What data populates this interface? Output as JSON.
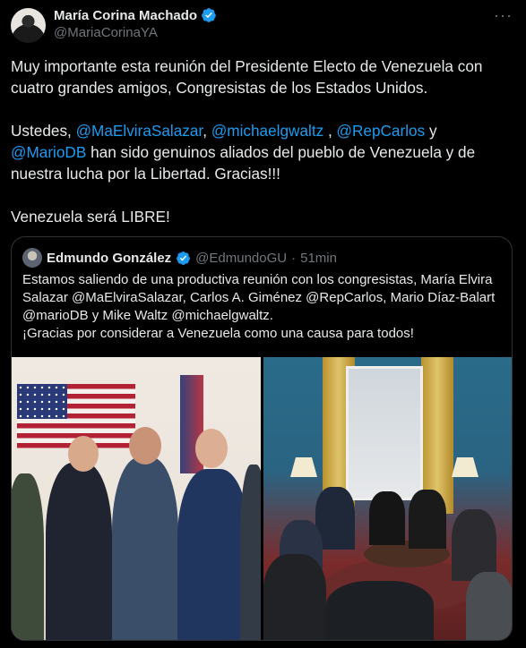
{
  "tweet": {
    "author_name": "María Corina Machado",
    "author_handle": "@MariaCorinaYA",
    "more_icon": "more-dots-icon",
    "text_line1": "Muy importante esta reunión del Presidente Electo de Venezuela con cuatro grandes amigos, Congresistas de los Estados Unidos.",
    "text_p2_prefix": "Ustedes, ",
    "mention1": "@MaElviraSalazar",
    "sep1": ", ",
    "mention2": "@michaelgwaltz",
    "sep2": " , ",
    "mention3": "@RepCarlos",
    "sep3": " y ",
    "mention4": "@MarioDB",
    "text_p2_suffix": " han sido genuinos aliados del pueblo de Venezuela y de nuestra lucha por la Libertad. Gracias!!!",
    "text_p3": "Venezuela será LIBRE!"
  },
  "quote": {
    "author_name": "Edmundo González",
    "author_handle": "@EdmundoGU",
    "dot": "·",
    "time": "51min",
    "text_line1": "Estamos saliendo de una productiva reunión con los congresistas, María Elvira Salazar @MaElviraSalazar, Carlos A. Giménez @RepCarlos, Mario Díaz-Balart @marioDB y Mike Waltz @michaelgwaltz.",
    "text_line2": "¡Gracias por considerar a Venezuela como una causa para todos!"
  },
  "colors": {
    "background": "#000000",
    "text": "#e7e9ea",
    "secondary": "#71767b",
    "accent": "#1d9bf0",
    "border": "#2f3336"
  }
}
